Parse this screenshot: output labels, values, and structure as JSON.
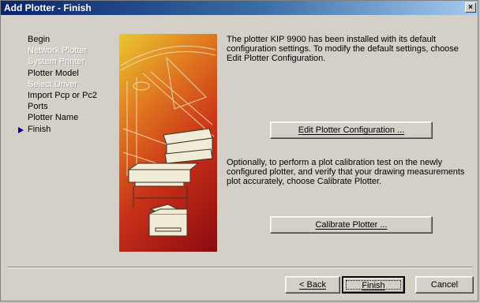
{
  "window": {
    "title": "Add Plotter - Finish",
    "close_glyph": "×"
  },
  "steps": [
    {
      "label": "Begin",
      "state": "normal"
    },
    {
      "label": "Network Plotter",
      "state": "disabled"
    },
    {
      "label": "System Printer",
      "state": "disabled"
    },
    {
      "label": "Plotter Model",
      "state": "normal"
    },
    {
      "label": "Select Driver",
      "state": "disabled"
    },
    {
      "label": "Import Pcp or Pc2",
      "state": "normal"
    },
    {
      "label": "Ports",
      "state": "normal"
    },
    {
      "label": "Plotter Name",
      "state": "normal"
    },
    {
      "label": "Finish",
      "state": "current"
    }
  ],
  "content": {
    "intro": "The plotter KIP 9900 has been installed with its default configuration settings.  To modify the default settings, choose Edit Plotter Configuration.",
    "edit_button": "Edit Plotter Configuration ...",
    "calibrate_text": "Optionally, to perform a plot calibration test on the newly configured plotter, and verify that your drawing measurements plot accurately, choose Calibrate Plotter.",
    "calibrate_button": "Calibrate Plotter ..."
  },
  "footer": {
    "back": "< Back",
    "finish": "Finish",
    "cancel": "Cancel"
  },
  "colors": {
    "title_bar": "#0a246a",
    "dialog_bg": "#d4d0c8",
    "current_arrow": "#0000a8"
  }
}
